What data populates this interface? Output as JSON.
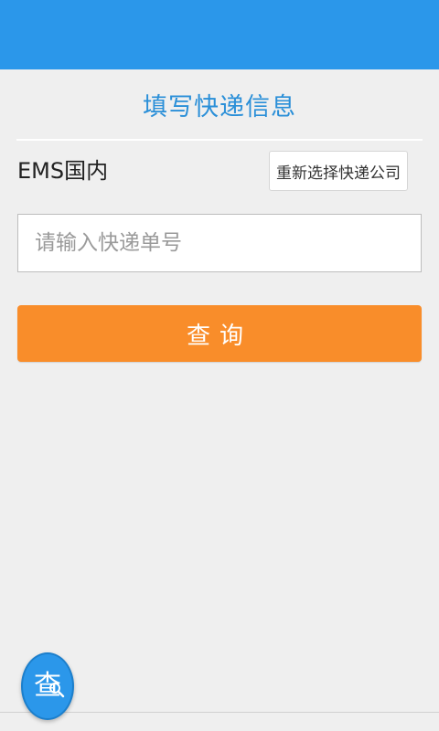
{
  "header": {
    "title": "填写快递信息"
  },
  "form": {
    "company_name": "EMS国内",
    "reselect_label": "重新选择快递公司",
    "tracking_placeholder": "请输入快递单号",
    "query_label": "查询"
  },
  "float_button": {
    "label": "查",
    "icon": "magnifier-icon"
  },
  "colors": {
    "status_bar": "#2b97ea",
    "title_text": "#2a8fd8",
    "query_button": "#f98d2a",
    "background": "#efefef"
  }
}
